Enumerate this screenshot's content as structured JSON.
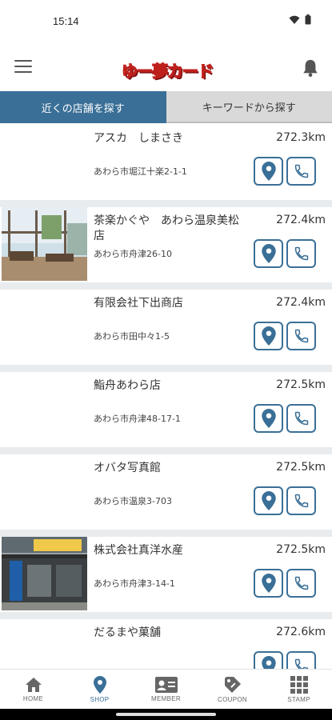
{
  "status_bar": {
    "time": "15:14"
  },
  "header": {
    "logo_text": "ゆー夢カード"
  },
  "tabs": [
    {
      "label": "近くの店舗を探す",
      "active": true
    },
    {
      "label": "キーワードから探す",
      "active": false
    }
  ],
  "stores": [
    {
      "name": "アスカ　しまさき",
      "distance": "272.3km",
      "address": "あわら市堀江十楽2-1-1",
      "has_image": false
    },
    {
      "name": "茶楽かぐや　あわら温泉美松店",
      "distance": "272.4km",
      "address": "あわら市舟津26-10",
      "has_image": true
    },
    {
      "name": "有限会社下出商店",
      "distance": "272.4km",
      "address": "あわら市田中々1-5",
      "has_image": false
    },
    {
      "name": "鮨舟あわら店",
      "distance": "272.5km",
      "address": "あわら市舟津48-17-1",
      "has_image": false
    },
    {
      "name": "オバタ写真館",
      "distance": "272.5km",
      "address": "あわら市温泉3-703",
      "has_image": false
    },
    {
      "name": "株式会社真洋水産",
      "distance": "272.5km",
      "address": "あわら市舟津3-14-1",
      "has_image": true
    },
    {
      "name": "だるまや菓舗",
      "distance": "272.6km",
      "address": "",
      "has_image": false
    }
  ],
  "bottom_nav": [
    {
      "label": "HOME",
      "icon": "home-icon",
      "active": false
    },
    {
      "label": "SHOP",
      "icon": "map-pin-icon",
      "active": true
    },
    {
      "label": "MEMBER",
      "icon": "member-card-icon",
      "active": false
    },
    {
      "label": "COUPON",
      "icon": "coupon-icon",
      "active": false
    },
    {
      "label": "STAMP",
      "icon": "grid-icon",
      "active": false
    }
  ],
  "colors": {
    "accent": "#3a6f97",
    "tab_inactive": "#d9d9d9",
    "list_bg": "#e9ecef"
  }
}
